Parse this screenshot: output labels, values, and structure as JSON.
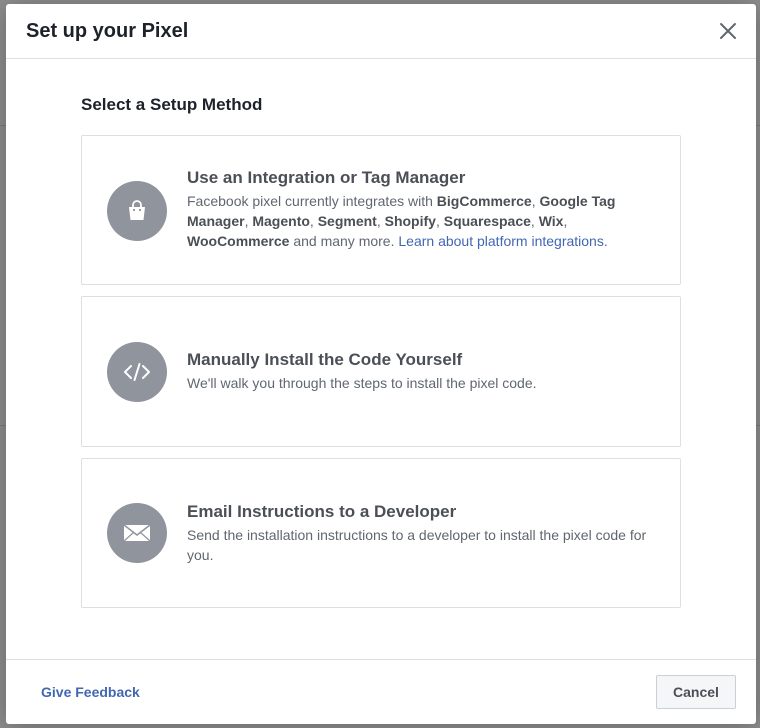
{
  "modal": {
    "title": "Set up your Pixel",
    "section_title": "Select a Setup Method"
  },
  "options": [
    {
      "title": "Use an Integration or Tag Manager",
      "desc_parts": [
        "Facebook pixel currently integrates with ",
        "BigCommerce",
        ", ",
        "Google Tag Manager",
        ", ",
        "Magento",
        ", ",
        "Segment",
        ", ",
        "Shopify",
        ", ",
        "Squarespace",
        ", ",
        "Wix",
        ",",
        "WooCommerce",
        " and many more. "
      ],
      "link": "Learn about platform integrations.",
      "icon": "shopping-bag-icon"
    },
    {
      "title": "Manually Install the Code Yourself",
      "desc": "We'll walk you through the steps to install the pixel code.",
      "icon": "code-icon"
    },
    {
      "title": "Email Instructions to a Developer",
      "desc": "Send the installation instructions to a developer to install the pixel code for you.",
      "icon": "envelope-icon"
    }
  ],
  "footer": {
    "feedback_label": "Give Feedback",
    "cancel_label": "Cancel"
  },
  "colors": {
    "accent": "#4267b2",
    "icon_bg": "#90949c"
  }
}
